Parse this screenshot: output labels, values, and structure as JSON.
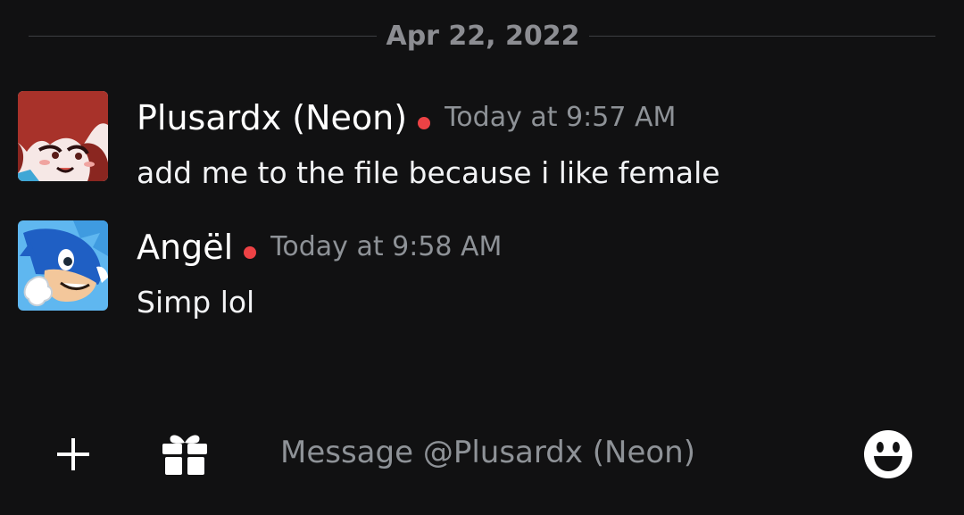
{
  "date_divider": {
    "label": "Apr 22, 2022"
  },
  "messages": [
    {
      "username": "Plusardx (Neon)",
      "timestamp": "Today at 9:57 AM",
      "text": "add me to the file because i like female",
      "status": "dnd"
    },
    {
      "username": "Angël",
      "timestamp": "Today at 9:58 AM",
      "text": "Simp lol",
      "status": "dnd"
    }
  ],
  "composer": {
    "placeholder": "Message @Plusardx (Neon)",
    "icons": [
      "plus-icon",
      "gift-icon",
      "emoji-icon"
    ]
  },
  "colors": {
    "background": "#111112",
    "status_dnd": "#ed4245",
    "muted_text": "#8e9297",
    "divider_line": "#3d3e42"
  }
}
